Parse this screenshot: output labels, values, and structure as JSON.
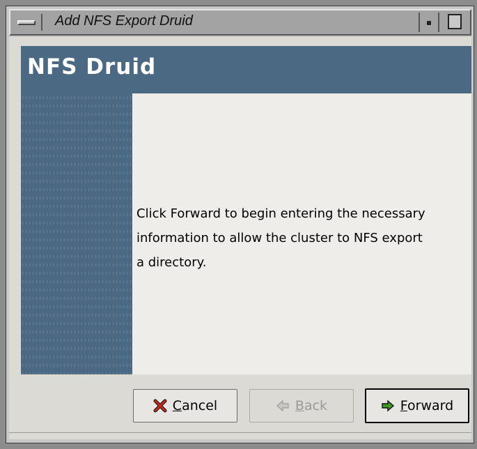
{
  "window": {
    "title": "Add NFS Export Druid"
  },
  "druid": {
    "title": "NFS Druid",
    "body_line1": "Click Forward to begin entering the necessary",
    "body_line2": "information to allow the cluster to NFS export",
    "body_line3": "a directory."
  },
  "buttons": {
    "cancel": {
      "mnemonic": "C",
      "rest": "ancel",
      "icon": "cancel-x-icon",
      "icon_color": "#c22b1b"
    },
    "back": {
      "mnemonic": "B",
      "rest": "ack",
      "icon": "back-arrow-icon",
      "enabled": false
    },
    "forward": {
      "mnemonic": "F",
      "rest": "orward",
      "icon": "forward-arrow-icon",
      "icon_color": "#2f7d1a"
    }
  },
  "colors": {
    "druid_blue": "#4b6983",
    "page_bg": "#efedea"
  }
}
